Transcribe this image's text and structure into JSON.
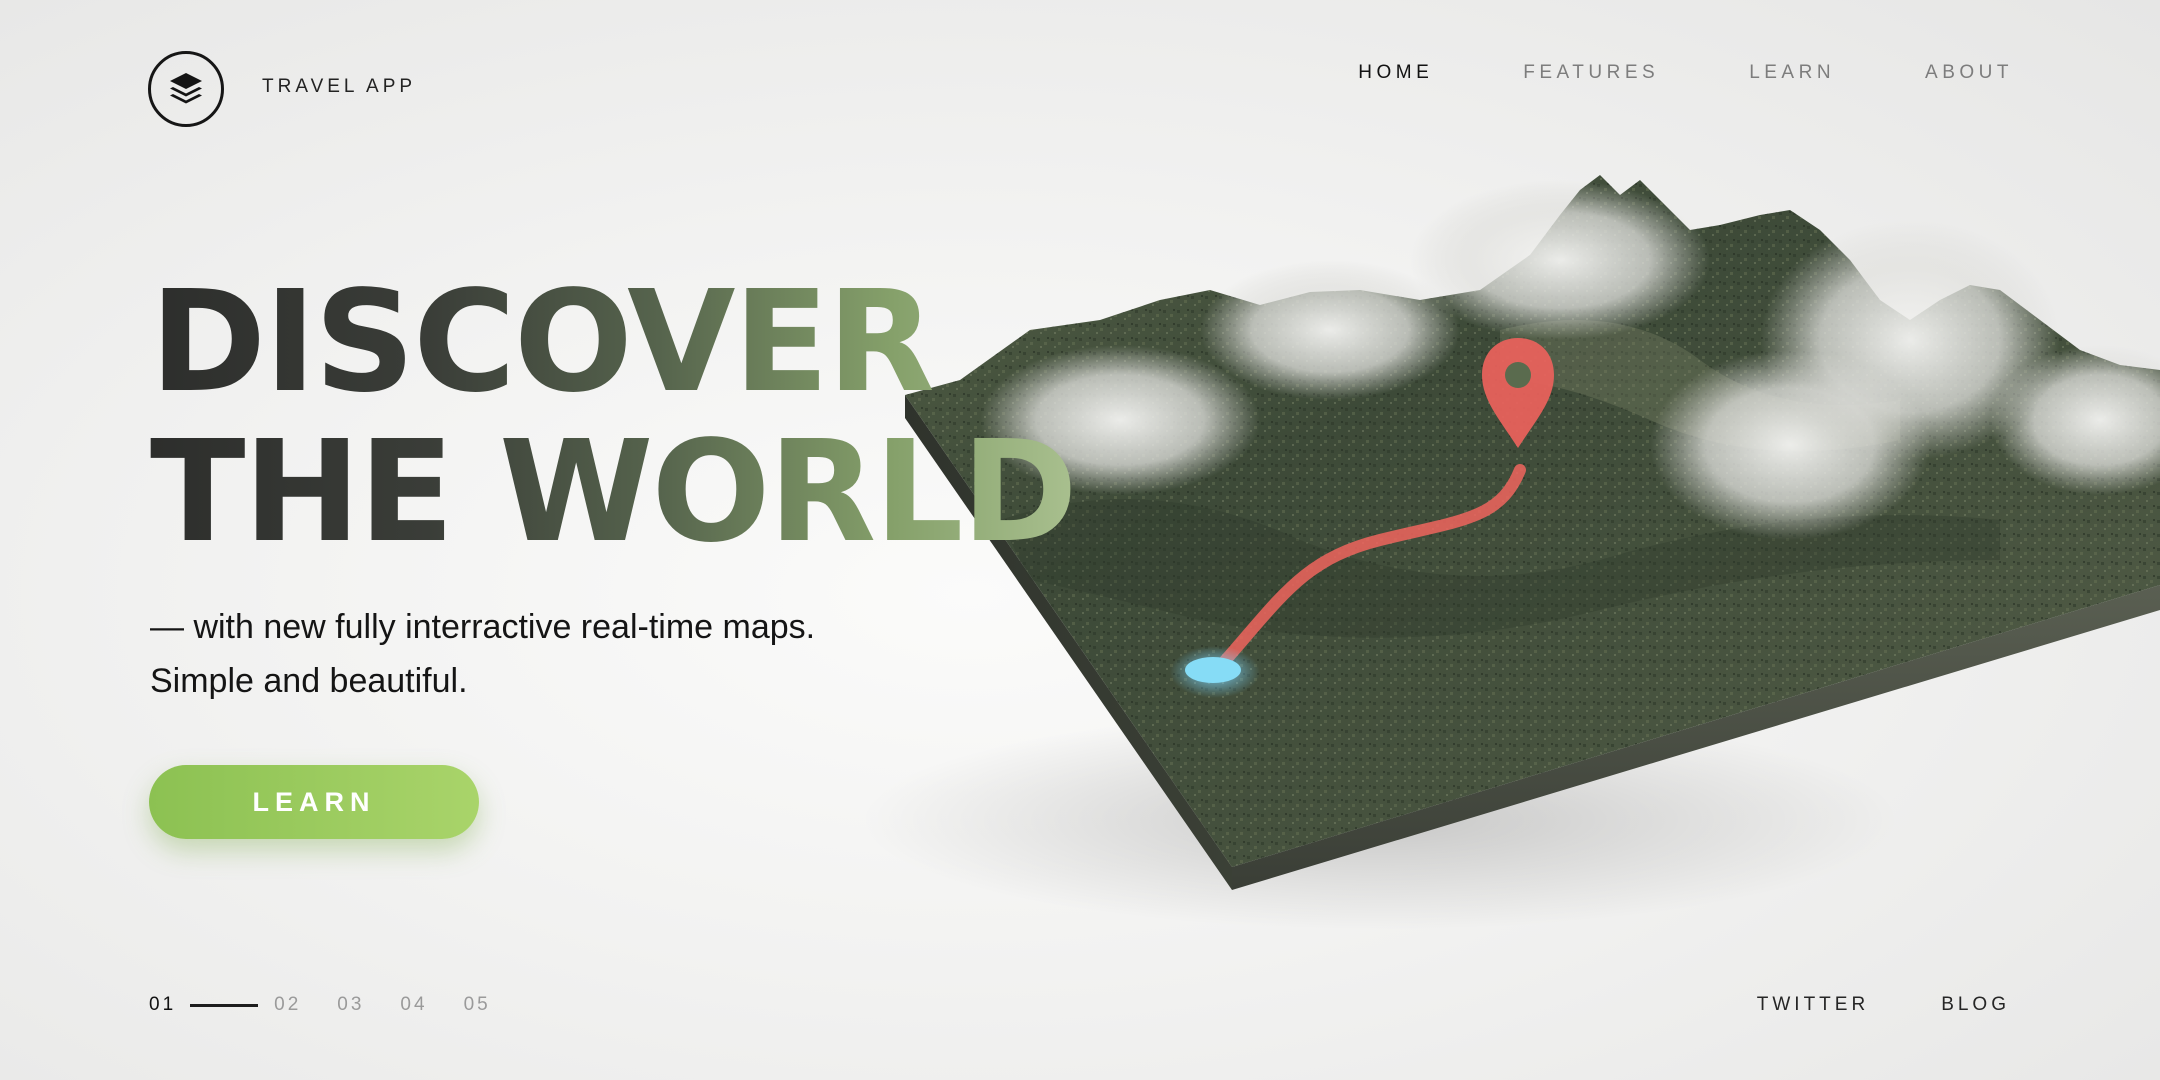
{
  "brand": {
    "name": "TRAVEL APP",
    "logo_icon": "layers-icon"
  },
  "nav": {
    "items": [
      {
        "label": "HOME",
        "active": true
      },
      {
        "label": "FEATURES",
        "active": false
      },
      {
        "label": "LEARN",
        "active": false
      },
      {
        "label": "ABOUT",
        "active": false
      }
    ]
  },
  "hero": {
    "title_line1": "DISCOVER",
    "title_line2": "THE WORLD",
    "subtitle_line1": "— with new fully interractive real-time maps.",
    "subtitle_line2": "Simple and beautiful.",
    "cta_label": "LEARN"
  },
  "pager": {
    "items": [
      "01",
      "02",
      "03",
      "04",
      "05"
    ],
    "active_index": 0
  },
  "footer": {
    "links": [
      "TWITTER",
      "BLOG"
    ]
  },
  "map": {
    "illustration": "3d-terrain-map",
    "pin_icon": "map-pin-icon",
    "start_marker": "location-dot-icon",
    "route_color": "#f0655e",
    "pin_color": "#ec625c",
    "start_color": "#86dcf6"
  },
  "colors": {
    "accent": "#9ccb5f",
    "text_dark": "#121212",
    "text_muted": "#7d7d7d"
  }
}
